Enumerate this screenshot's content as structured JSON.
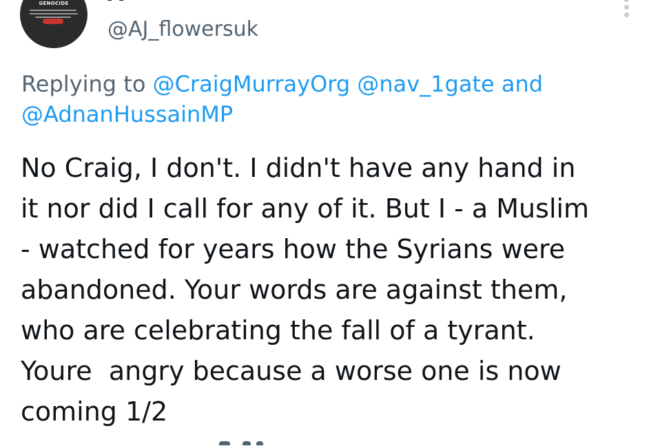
{
  "author": {
    "avatar_title": "GENOCIDE",
    "display_name": "A",
    "handle": "@AJ_flowersuk"
  },
  "reply_context": {
    "prefix": "Replying to",
    "mentions": [
      "@CraigMurrayOrg",
      "@nav_1gate",
      "@AdnanHussainMP"
    ],
    "conjunction": "and"
  },
  "tweet": {
    "lines": [
      "No Craig, I don't. I didn't have any hand in",
      "it nor did I call for any of it. But I - a Muslim",
      "- watched for years how the Syrians were",
      "abandoned. Your words are against them,",
      "who are celebrating the fall of a tyrant.",
      "Youre  angry because a worse one is now",
      "coming 1/2"
    ]
  },
  "icons": {
    "more_menu": "more-vertical-icon"
  },
  "colors": {
    "text_primary": "#0f1419",
    "text_secondary": "#536471",
    "link": "#1d9bf0",
    "background": "#ffffff"
  }
}
